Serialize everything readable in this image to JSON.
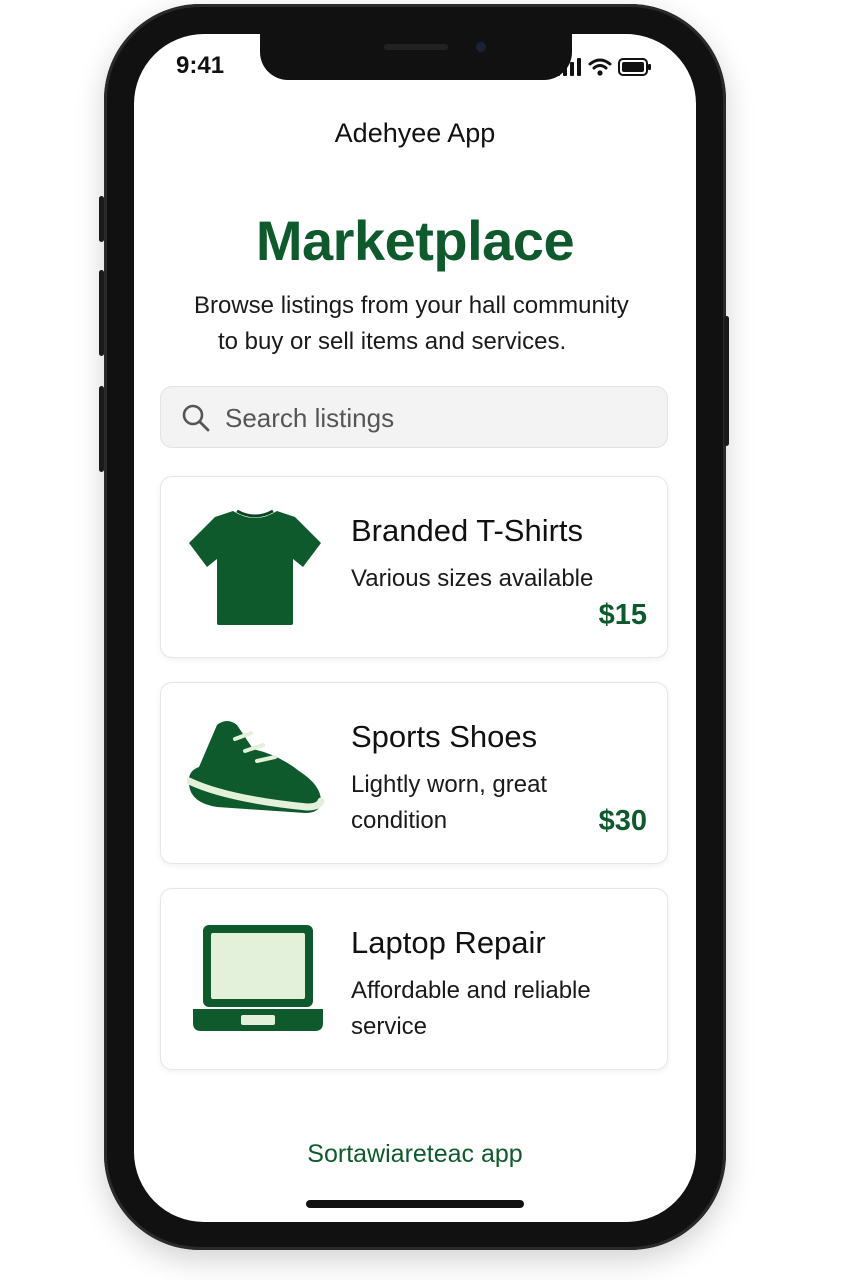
{
  "status_bar": {
    "time": "9:41",
    "signal_icon": "signal-bars-icon",
    "wifi_icon": "wifi-icon",
    "battery_icon": "battery-icon"
  },
  "header": {
    "app_title": "Adehyee App"
  },
  "main": {
    "title": "Marketplace",
    "subtitle_line1": "Browse listings from your hall community",
    "subtitle_line2": "to buy or sell items and services."
  },
  "search": {
    "placeholder": "Search listings",
    "icon": "search-icon"
  },
  "listings": [
    {
      "title": "Branded T-Shirts",
      "description": "Various sizes available",
      "price": "$15",
      "icon": "tshirt-icon"
    },
    {
      "title": "Sports Shoes",
      "description": "Lightly worn, great condition",
      "price": "$30",
      "icon": "sneaker-icon"
    },
    {
      "title": "Laptop Repair",
      "description": "Affordable and reliable service",
      "price": "",
      "icon": "laptop-icon"
    }
  ],
  "footer": {
    "brand_text": "Sortawiareteac app"
  },
  "colors": {
    "brand_green": "#0f5a2c",
    "light_green": "#e3f0da",
    "search_bg": "#f3f3f3"
  }
}
